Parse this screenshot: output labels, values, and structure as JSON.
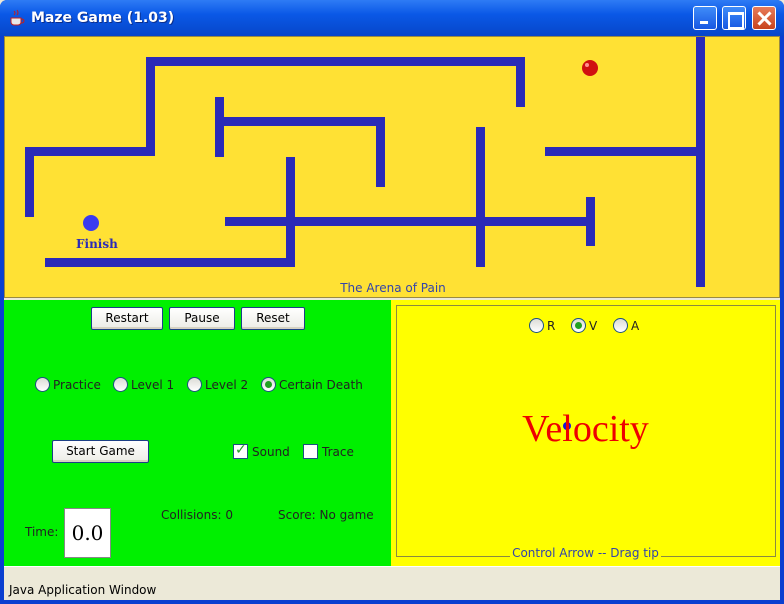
{
  "window": {
    "title": "Maze Game (1.03)",
    "title_icon": "java-cup-icon",
    "controls": [
      "minimize",
      "maximize",
      "close"
    ]
  },
  "arena": {
    "finish_label": "Finish",
    "caption": "The Arena of Pain",
    "background": "#FFE134",
    "wall_color": "#2A2AB8",
    "ball_color": "#D01010",
    "finish_color": "#3A3AF0"
  },
  "controls": {
    "buttons": {
      "restart": "Restart",
      "pause": "Pause",
      "reset": "Reset",
      "start": "Start Game"
    },
    "levels": [
      {
        "label": "Practice",
        "selected": false
      },
      {
        "label": "Level 1",
        "selected": false
      },
      {
        "label": "Level 2",
        "selected": false
      },
      {
        "label": "Certain Death",
        "selected": true
      }
    ],
    "options": [
      {
        "label": "Sound",
        "checked": true
      },
      {
        "label": "Trace",
        "checked": false
      }
    ],
    "time_label": "Time:",
    "time_value": "0.0",
    "collisions": "Collisions: 0",
    "score": "Score: No game",
    "background": "#00F000"
  },
  "velocity": {
    "modes": [
      {
        "label": "R",
        "selected": false
      },
      {
        "label": "V",
        "selected": true
      },
      {
        "label": "A",
        "selected": false
      }
    ],
    "display": "Velocity",
    "caption": "Control Arrow -- Drag tip",
    "background": "#FFFF00"
  },
  "status": {
    "text": "Java Application Window"
  }
}
